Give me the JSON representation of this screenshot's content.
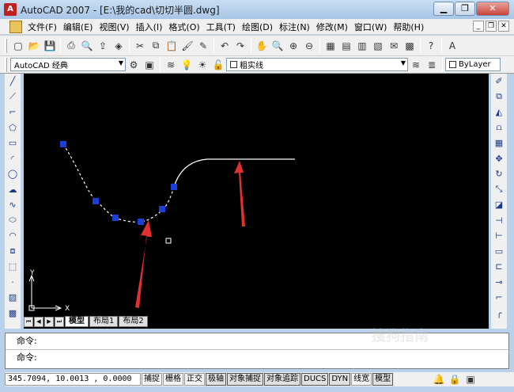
{
  "window": {
    "title": "AutoCAD 2007 - [E:\\我的cad\\切切半圆.dwg]",
    "app_icon": "autocad-logo-icon"
  },
  "menu": {
    "items": [
      {
        "label": "文件(F)"
      },
      {
        "label": "编辑(E)"
      },
      {
        "label": "视图(V)"
      },
      {
        "label": "插入(I)"
      },
      {
        "label": "格式(O)"
      },
      {
        "label": "工具(T)"
      },
      {
        "label": "绘图(D)"
      },
      {
        "label": "标注(N)"
      },
      {
        "label": "修改(M)"
      },
      {
        "label": "窗口(W)"
      },
      {
        "label": "帮助(H)"
      }
    ]
  },
  "toolbar2": {
    "workspace": "AutoCAD 经典",
    "layer": "粗实线",
    "bylayer": "ByLayer"
  },
  "layout_tabs": {
    "model": "模型",
    "layout1": "布局1",
    "layout2": "布局2"
  },
  "ucs": {
    "x_label": "X",
    "y_label": "Y"
  },
  "command": {
    "line1": "命令:",
    "line2": "命令:"
  },
  "status": {
    "coords": "345.7094, 10.0013 , 0.0000",
    "buttons": [
      "捕捉",
      "栅格",
      "正交",
      "极轴",
      "对象捕捉",
      "对象追踪",
      "DUCS",
      "DYN",
      "线宽",
      "模型"
    ]
  },
  "watermark": "搜狗指南",
  "colors": {
    "canvas": "#000000",
    "grip": "#1a3fd6",
    "arrow": "#e03030",
    "curve": "#ffffff"
  }
}
